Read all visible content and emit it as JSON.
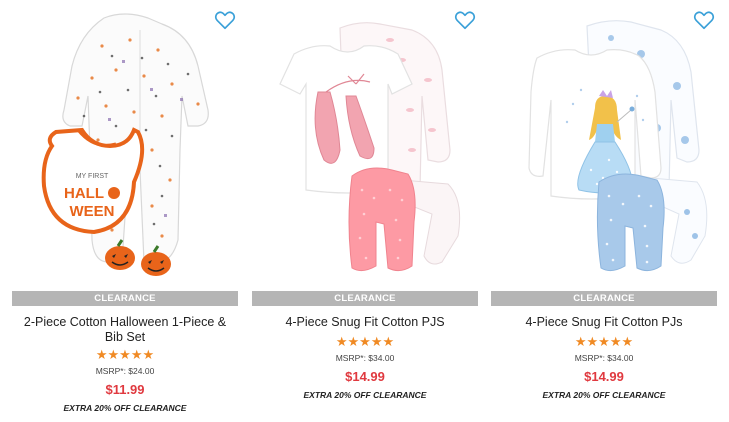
{
  "products": [
    {
      "badge": "CLEARANCE",
      "name": "2-Piece Cotton Halloween 1-Piece & Bib Set",
      "stars": "★★★★★",
      "rating": 5,
      "msrp": "MSRP*: $24.00",
      "price": "$11.99",
      "promo": "EXTRA 20% OFF CLEARANCE",
      "bib_text_top": "MY FIRST",
      "bib_text_mid": "HALL",
      "bib_text_bottom": "WEEN",
      "wishlist_icon": "heart-outline-icon"
    },
    {
      "badge": "CLEARANCE",
      "name": "4-Piece Snug Fit Cotton PJS",
      "stars": "★★★★★",
      "rating": 5,
      "msrp": "MSRP*: $34.00",
      "price": "$14.99",
      "promo": "EXTRA 20% OFF CLEARANCE",
      "wishlist_icon": "heart-outline-icon"
    },
    {
      "badge": "CLEARANCE",
      "name": "4-Piece Snug Fit Cotton PJs",
      "stars": "★★★★★",
      "rating": 5,
      "msrp": "MSRP*: $34.00",
      "price": "$14.99",
      "promo": "EXTRA 20% OFF CLEARANCE",
      "wishlist_icon": "heart-outline-icon"
    }
  ],
  "colors": {
    "accent_blue": "#3aa0d8",
    "badge_gray": "#b5b5b5",
    "star_orange": "#f08a24",
    "price_red": "#e0393f"
  }
}
